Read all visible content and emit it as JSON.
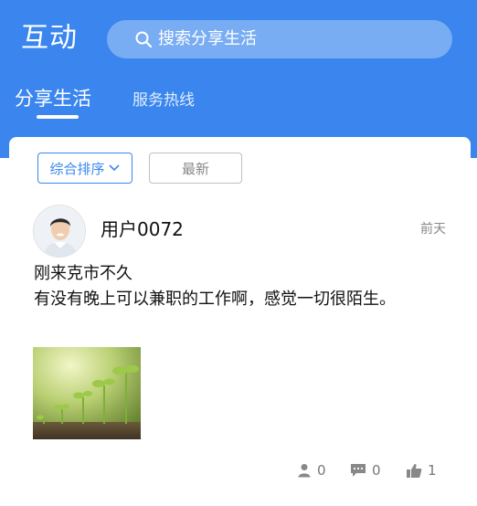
{
  "header": {
    "title": "互动",
    "search_placeholder": "搜索分享生活",
    "tabs": [
      {
        "label": "分享生活",
        "active": true
      },
      {
        "label": "服务热线",
        "active": false
      }
    ],
    "color": "#3a86ee"
  },
  "filters": {
    "sort_label": "综合排序",
    "newest_label": "最新"
  },
  "post": {
    "username": "用户0072",
    "time": "前天",
    "text_line1": "刚来克市不久",
    "text_line2": "有没有晚上可以兼职的工作啊，感觉一切很陌生。",
    "stats": {
      "views": "0",
      "comments": "0",
      "likes": "1"
    }
  }
}
